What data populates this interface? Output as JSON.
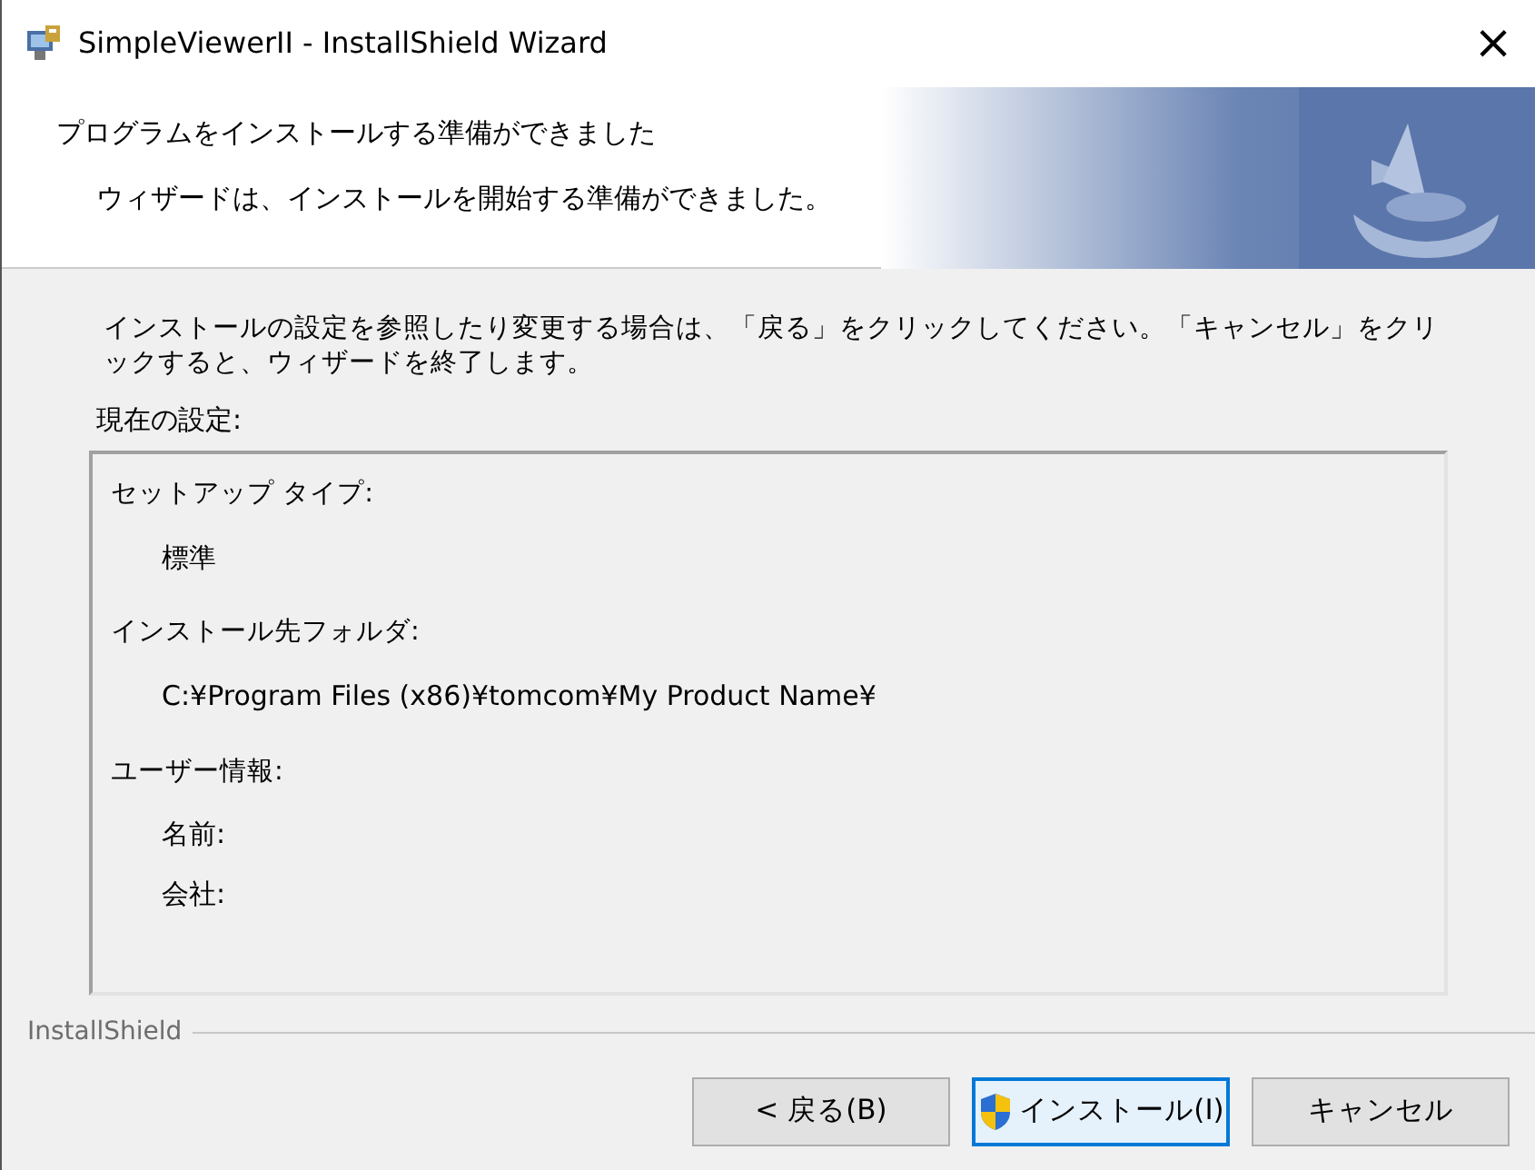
{
  "window": {
    "title": "SimpleViewerII - InstallShield Wizard",
    "close": "×"
  },
  "header": {
    "title": "プログラムをインストールする準備ができました",
    "subtitle": "ウィザードは、インストールを開始する準備ができました。"
  },
  "description": "インストールの設定を参照したり変更する場合は、「戻る」をクリックしてください。「キャンセル」をクリックすると、ウィザードを終了します。",
  "settings_label": "現在の設定:",
  "settings": [
    {
      "kind": "heading",
      "text": "セットアップ タイプ:"
    },
    {
      "kind": "value",
      "text": "標準"
    },
    {
      "kind": "heading",
      "text": "インストール先フォルダ:"
    },
    {
      "kind": "value",
      "text": "C:¥Program Files (x86)¥tomcom¥My Product Name¥"
    },
    {
      "kind": "heading",
      "text": "ユーザー情報:"
    },
    {
      "kind": "field",
      "text": "名前:"
    },
    {
      "kind": "field",
      "text": "会社:"
    }
  ],
  "brand": "InstallShield",
  "buttons": [
    {
      "label": "< 戻る(B)",
      "shield": false,
      "focused": false
    },
    {
      "label": "インストール(I)",
      "shield": true,
      "focused": true
    },
    {
      "label": "キャンセル",
      "shield": false,
      "focused": false
    }
  ]
}
